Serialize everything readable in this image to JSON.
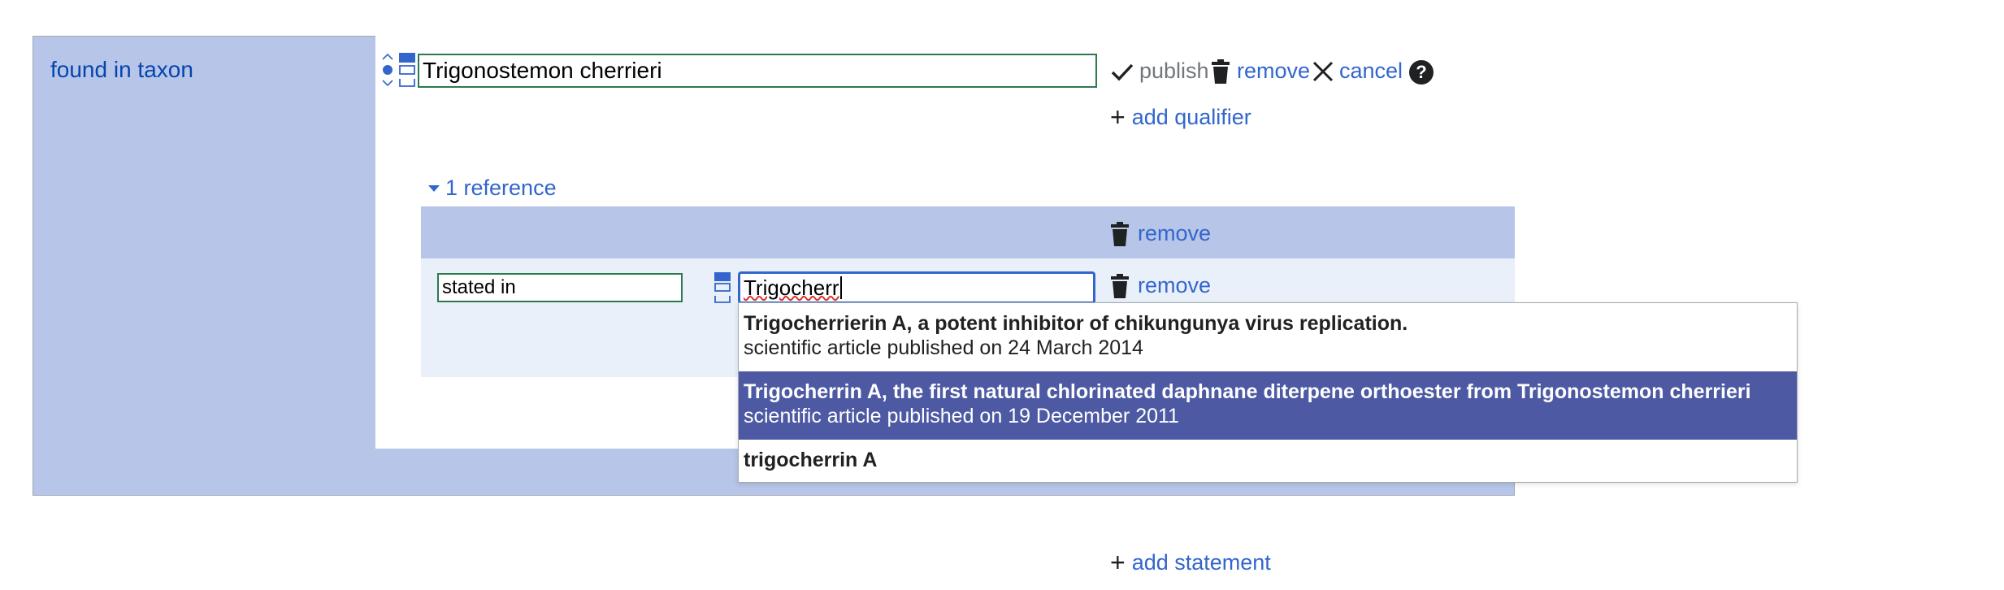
{
  "statement": {
    "property_label": "found in taxon",
    "value": "Trigonostemon cherrieri",
    "toolbar": {
      "publish_label": "publish",
      "remove_label": "remove",
      "cancel_label": "cancel",
      "help_label": "?"
    },
    "add_qualifier_label": "add qualifier"
  },
  "references": {
    "toggle_label": "1 reference",
    "remove_reference_label": "remove",
    "snak": {
      "property": "stated in",
      "value": "Trigocherr",
      "remove_label": "remove"
    }
  },
  "suggestions": [
    {
      "title": "Trigocherrierin A, a potent inhibitor of chikungunya virus replication.",
      "description": "scientific article published on 24 March 2014",
      "selected": false
    },
    {
      "title": "Trigocherrin A, the first natural chlorinated daphnane diterpene orthoester from Trigonostemon cherrieri",
      "description": "scientific article published on 19 December 2011",
      "selected": true
    },
    {
      "title": "trigocherrin A",
      "description": "",
      "selected": false
    }
  ],
  "add_statement_label": "add statement",
  "colors": {
    "link": "#3366cc",
    "group_bg": "#b6c5e8",
    "reference_bg": "#eaf0f9",
    "selected_suggestion_bg": "#4d5aa3",
    "input_border_valid": "#2c7a4b"
  }
}
